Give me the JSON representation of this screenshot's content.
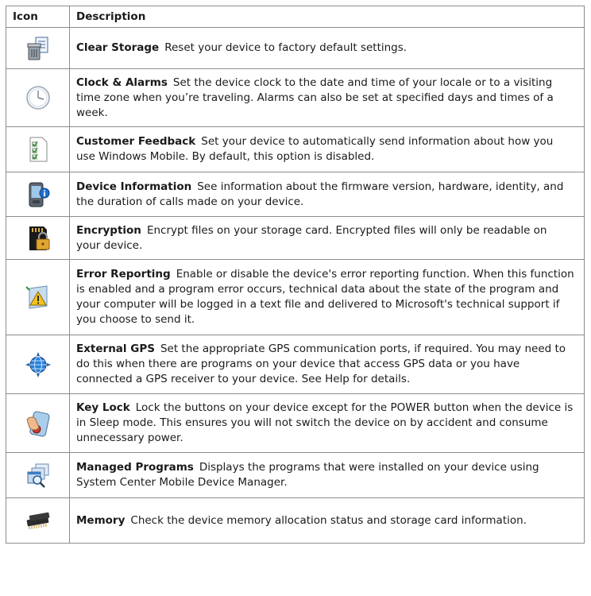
{
  "header": {
    "icon": "Icon",
    "description": "Description"
  },
  "rows": [
    {
      "icon": "clear-storage-icon",
      "title": "Clear Storage",
      "text": "Reset your device to factory default settings."
    },
    {
      "icon": "clock-icon",
      "title": "Clock & Alarms",
      "text": "Set the device clock to the date and time of your locale or to a visiting time zone when you’re traveling. Alarms can also be set at specified days and times of a week."
    },
    {
      "icon": "customer-feedback-icon",
      "title": "Customer Feedback",
      "text": "Set your device to automatically send information about how you use Windows Mobile. By default, this option is disabled."
    },
    {
      "icon": "device-information-icon",
      "title": "Device Information",
      "text": "See information about the firmware version, hardware, identity, and the duration of calls made on your device."
    },
    {
      "icon": "encryption-icon",
      "title": "Encryption",
      "text": "Encrypt files on your storage card. Encrypted files will only be readable on your device."
    },
    {
      "icon": "error-reporting-icon",
      "title": "Error Reporting",
      "text": "Enable or disable the device's error reporting function. When this function is enabled and a program error occurs, technical data about the state of the program and your computer will be logged in a text file and delivered to Microsoft's technical support if you choose to send it."
    },
    {
      "icon": "external-gps-icon",
      "title": "External GPS",
      "text": "Set the appropriate GPS communication ports, if required. You may need to do this when there are programs on your device that access GPS data or you have connected a GPS receiver to your device. See Help for details."
    },
    {
      "icon": "key-lock-icon",
      "title": "Key Lock",
      "text": "Lock the buttons on your device except for the POWER button when the device is in Sleep mode. This ensures you will not switch the device on by accident and consume unnecessary power."
    },
    {
      "icon": "managed-programs-icon",
      "title": "Managed Programs",
      "text": "Displays the programs that were installed on your device using System Center Mobile Device Manager."
    },
    {
      "icon": "memory-icon",
      "title": "Memory",
      "text": "Check the device memory allocation status and storage card information."
    }
  ]
}
